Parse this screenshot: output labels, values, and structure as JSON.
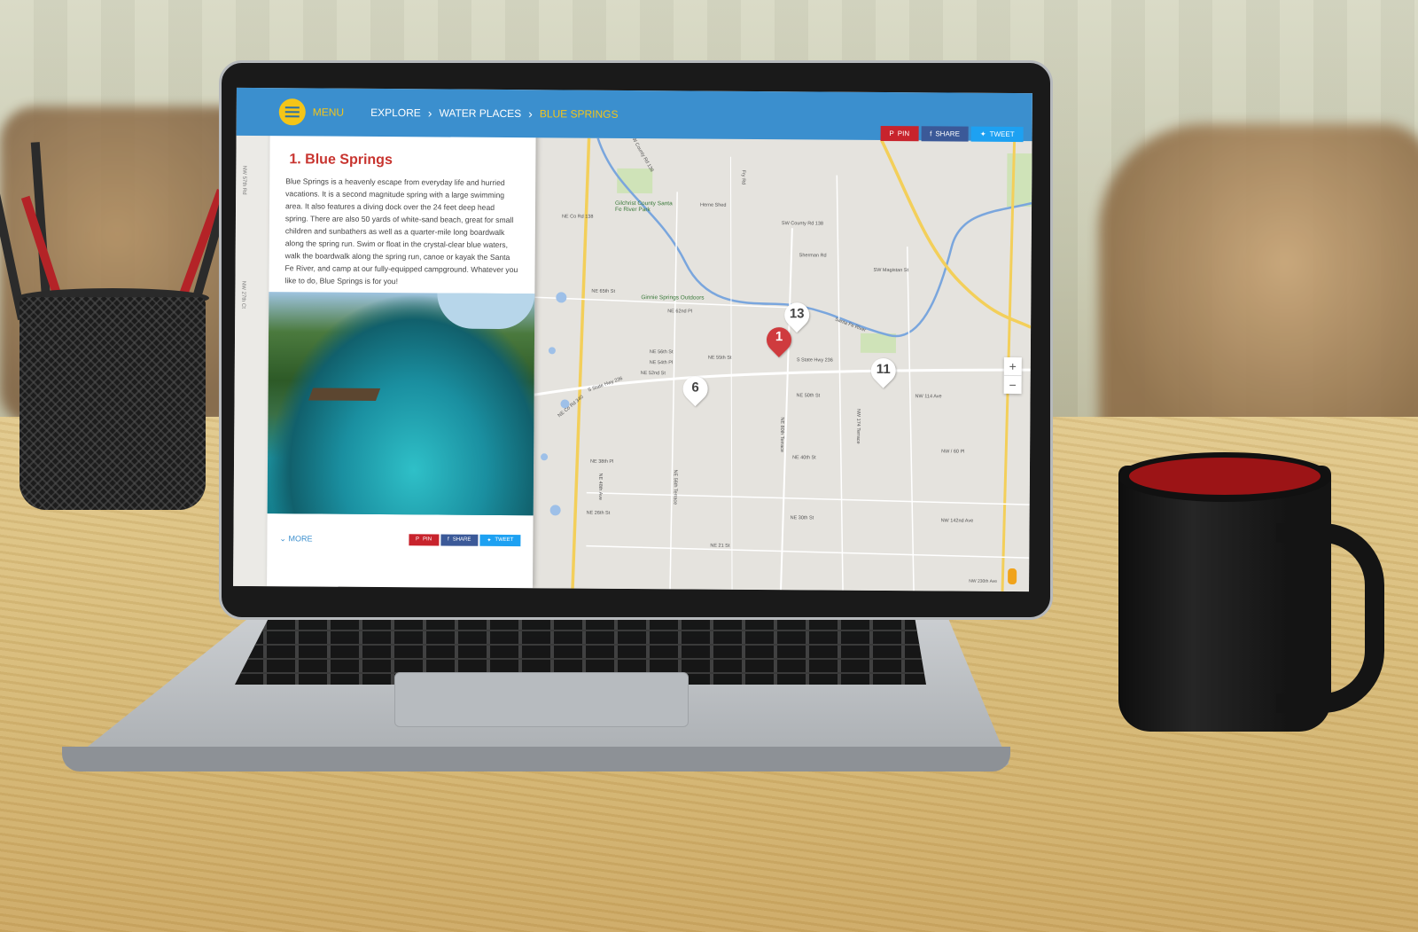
{
  "header": {
    "menu_label": "MENU",
    "breadcrumb": [
      "EXPLORE",
      "WATER PLACES",
      "BLUE SPRINGS"
    ]
  },
  "share": {
    "pin": "PIN",
    "share": "SHARE",
    "tweet": "TWEET"
  },
  "footer_share": {
    "pin": "PIN",
    "share": "SHARE",
    "tweet": "TWEET"
  },
  "panel": {
    "title": "1. Blue Springs",
    "description": "Blue Springs is a heavenly escape from everyday life and hurried vacations. It is a second magnitude spring with a large swimming area. It also features a diving dock over the 24 feet deep head spring. There are also 50 yards of white-sand beach, great for small children and sunbathers as well as a quarter-mile long boardwalk along the spring run. Swim or float in the crystal-clear blue waters, walk the boardwalk along the spring run, canoe or kayak the Santa Fe River, and camp at our fully-equipped campground. Whatever you like to do, Blue Springs is for you!",
    "more_label": "MORE",
    "side_labels": [
      "NW 57th Rd",
      "NW 27th Ct"
    ]
  },
  "map": {
    "markers": [
      {
        "label": "1",
        "color": "#cf3b3e",
        "active": true
      },
      {
        "label": "13",
        "color": "#ffffff",
        "active": false
      },
      {
        "label": "11",
        "color": "#ffffff",
        "active": false
      },
      {
        "label": "6",
        "color": "#ffffff",
        "active": false
      }
    ],
    "labels": {
      "sw_county_rd": "SW County Rd 138",
      "ichetucknee": "Gilchrist County Santa Fe River Park",
      "ginnie": "Ginnie Springs Outdoors",
      "ne_65th": "NE 65th St",
      "ne_62nd": "NE 62nd Pl",
      "ne_56th": "NE 56th St",
      "ne_55th": "NE 55th St",
      "ne_54th": "NE 54th Pl",
      "ne_52nd": "NE 52nd St",
      "state_hwy_236": "S State Hwy 236",
      "ne_50th": "NE 50th St",
      "nw_114": "NW 114 Ave",
      "ne_40th": "NE 40th St",
      "nw_60": "NW / 60 Pl",
      "ne_38th": "NE 38th Pl",
      "ne_30th": "NE 30th St",
      "nw_142nd": "NW 142nd Ave",
      "ne_26th": "NE 26th St",
      "ne_21": "NE 21 St",
      "ne_60th": "NE 60th Ave",
      "nw_174": "NW 174 Terrace",
      "sw_magistan": "SW Magistan St",
      "sherman": "Sherman Rd",
      "herne": "Herne Shed",
      "fry": "Fry Rd",
      "sw_county_rd2": "SW County Rd 138",
      "santa_fe": "Santa Fe River",
      "nw_230": "NW 230th Ave",
      "ne_co_rd_138": "NE Co Rd 138",
      "ne_co_rd_340": "NE Co Rd 340",
      "state_hwy_236b": "S State Hwy 236",
      "ne_43rd": "NE 43rd Ave",
      "ne_56th_ter": "NE 56th Terrace",
      "ne_80th": "NE 80th Terrace",
      "ne_48th": "NE 48th Ave"
    },
    "zoom_in": "+",
    "zoom_out": "−",
    "attribution": "NW 230th Ave"
  }
}
